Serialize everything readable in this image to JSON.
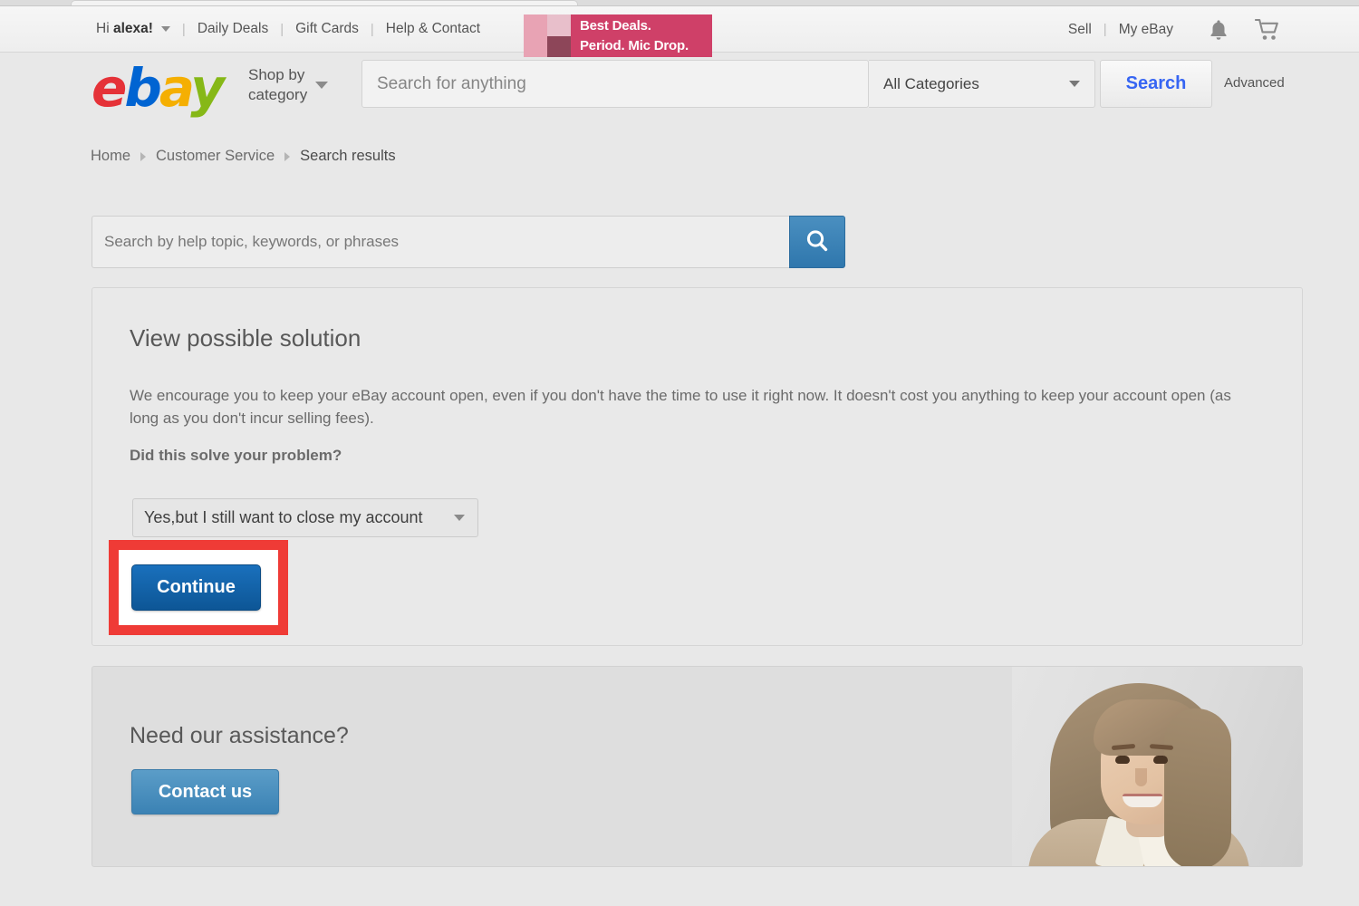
{
  "top_bar": {
    "greeting_prefix": "Hi ",
    "greeting_user": "alexa!",
    "links": [
      {
        "label": "Daily Deals"
      },
      {
        "label": "Gift Cards"
      },
      {
        "label": "Help & Contact"
      }
    ],
    "separator": "|",
    "right_links": [
      {
        "label": "Sell"
      },
      {
        "label": "My eBay"
      }
    ],
    "bell_icon": "bell-icon",
    "cart_icon": "cart-icon"
  },
  "promo": {
    "line1": "Best Deals.",
    "line2": "Period. Mic Drop.",
    "background": "#cf4068"
  },
  "header": {
    "logo": {
      "e": "e",
      "b": "b",
      "a": "a",
      "y": "y"
    },
    "shop_by_category": "Shop by\ncategory",
    "search_placeholder": "Search for anything",
    "search_value": "",
    "category_selected": "All Categories",
    "search_button": "Search",
    "advanced_link": "Advanced"
  },
  "breadcrumb": {
    "items": [
      {
        "label": "Home"
      },
      {
        "label": "Customer Service"
      },
      {
        "label": "Search results"
      }
    ]
  },
  "help_search": {
    "placeholder": "Search by help topic, keywords, or phrases",
    "value": "",
    "icon": "search-icon",
    "button_color": "#2f77ad"
  },
  "solution": {
    "title": "View possible solution",
    "body": "We encourage you to keep your eBay account open, even if you don't have the time to use it right now. It doesn't cost you anything to keep your account open (as long as you don't incur selling fees).",
    "question": "Did this solve your problem?",
    "select_value": "Yes,but I still want to close my account",
    "continue_label": "Continue",
    "highlight_color": "#ef3b36",
    "continue_color": "#0d5696"
  },
  "assistance": {
    "title": "Need our assistance?",
    "contact_label": "Contact us",
    "contact_color": "#3b82b4",
    "photo": "customer-service-agent-photo"
  }
}
